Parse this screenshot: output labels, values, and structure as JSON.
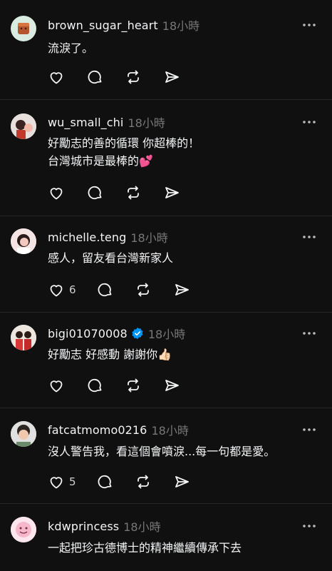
{
  "comments": [
    {
      "username": "brown_sugar_heart",
      "time": "18小時",
      "text": "流淚了。",
      "likes": null,
      "verified": false
    },
    {
      "username": "wu_small_chi",
      "time": "18小時",
      "text": "好勵志的善的循環 你超棒的！\n台灣城市是最棒的💕",
      "likes": null,
      "verified": false
    },
    {
      "username": "michelle.teng",
      "time": "18小時",
      "text": "感人，留友看台灣新家人",
      "likes": "6",
      "verified": false
    },
    {
      "username": "bigi01070008",
      "time": "18小時",
      "text": "好勵志 好感動 謝謝你👍🏻",
      "likes": null,
      "verified": true
    },
    {
      "username": "fatcatmomo0216",
      "time": "18小時",
      "text": "沒人警告我，看這個會噴淚...每一句都是愛。",
      "likes": "5",
      "verified": false
    },
    {
      "username": "kdwprincess",
      "time": "18小時",
      "text": "一起把珍古德博士的精神繼續傳承下去",
      "likes": null,
      "verified": false
    }
  ],
  "icons": {
    "more": "more-horizontal-icon",
    "like": "heart-icon",
    "reply": "comment-bubble-icon",
    "repost": "repost-icon",
    "share": "send-icon",
    "verified": "verified-badge-icon"
  },
  "colors": {
    "background": "#101010",
    "text": "#f3f5f7",
    "secondary": "#777777",
    "verified": "#0095f6",
    "divider": "#262626"
  }
}
